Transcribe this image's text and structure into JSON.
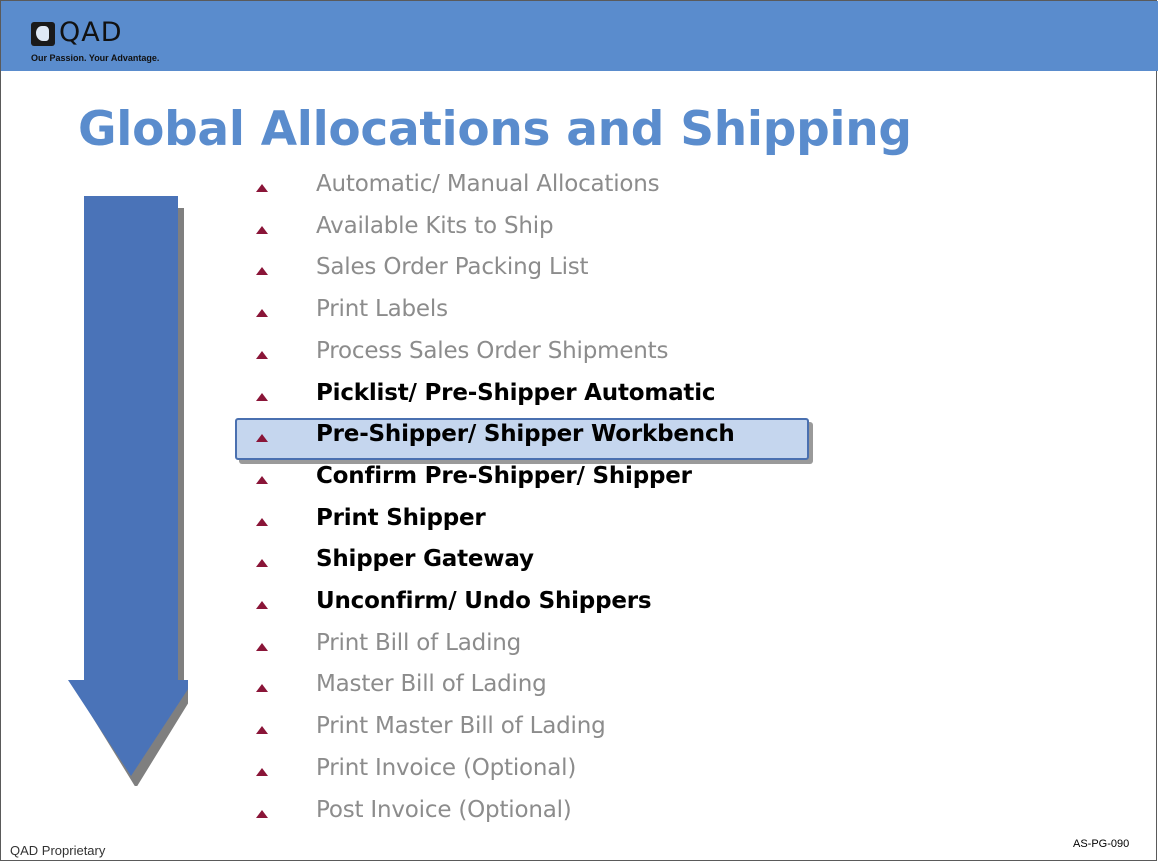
{
  "header": {
    "logo_text": "QAD",
    "tagline": "Our Passion. Your Advantage.",
    "color": "#5a8ccd"
  },
  "title": "Global Allocations and Shipping",
  "arrow": {
    "color": "#4a73b8",
    "direction": "down"
  },
  "bullet_icon": "triangle-up-icon",
  "items": [
    {
      "label": "Automatic/ Manual Allocations",
      "emphasis": false
    },
    {
      "label": "Available Kits to Ship",
      "emphasis": false
    },
    {
      "label": "Sales Order Packing List",
      "emphasis": false
    },
    {
      "label": "Print Labels",
      "emphasis": false
    },
    {
      "label": "Process Sales Order Shipments",
      "emphasis": false
    },
    {
      "label": "Picklist/ Pre-Shipper Automatic",
      "emphasis": true
    },
    {
      "label": "Pre-Shipper/ Shipper Workbench",
      "emphasis": true,
      "highlighted": true
    },
    {
      "label": "Confirm Pre-Shipper/ Shipper",
      "emphasis": true
    },
    {
      "label": "Print Shipper",
      "emphasis": true
    },
    {
      "label": "Shipper Gateway",
      "emphasis": true
    },
    {
      "label": "Unconfirm/ Undo Shippers",
      "emphasis": true
    },
    {
      "label": "Print Bill of Lading",
      "emphasis": false
    },
    {
      "label": "Master Bill of Lading",
      "emphasis": false
    },
    {
      "label": "Print Master Bill of Lading",
      "emphasis": false
    },
    {
      "label": "Print Invoice (Optional)",
      "emphasis": false
    },
    {
      "label": "Post Invoice (Optional)",
      "emphasis": false
    }
  ],
  "footer": {
    "left": "QAD Proprietary",
    "right": "AS-PG-090"
  }
}
